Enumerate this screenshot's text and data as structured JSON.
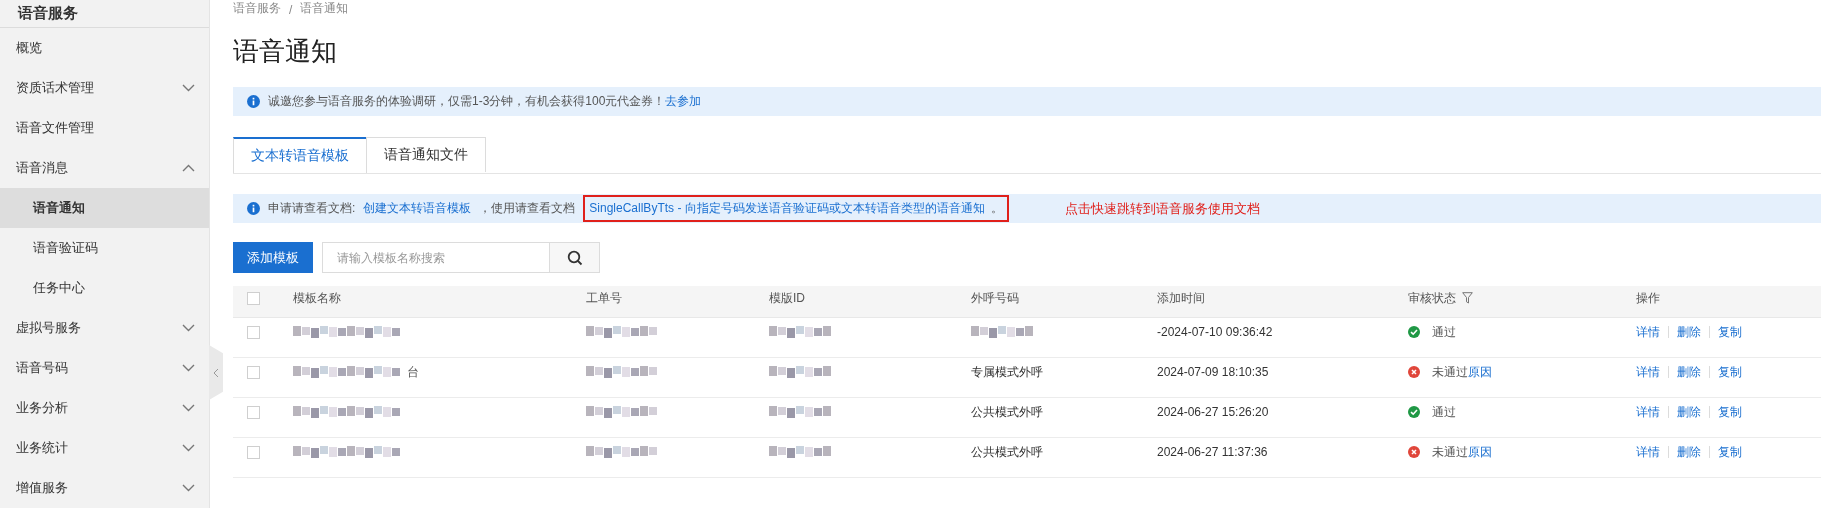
{
  "sidebar": {
    "title": "语音服务",
    "items": [
      {
        "label": "概览"
      },
      {
        "label": "资质话术管理",
        "expanded": false
      },
      {
        "label": "语音文件管理"
      },
      {
        "label": "语音消息",
        "expanded": true,
        "children": [
          {
            "label": "语音通知",
            "selected": true
          },
          {
            "label": "语音验证码",
            "selected": false
          },
          {
            "label": "任务中心",
            "selected": false
          }
        ]
      },
      {
        "label": "虚拟号服务",
        "expanded": false
      },
      {
        "label": "语音号码",
        "expanded": false
      },
      {
        "label": "业务分析",
        "expanded": false
      },
      {
        "label": "业务统计",
        "expanded": false
      },
      {
        "label": "增值服务",
        "expanded": false
      }
    ]
  },
  "breadcrumb": [
    "语音服务",
    "/",
    "语音通知"
  ],
  "page_title": "语音通知",
  "survey_notice": {
    "text": "诚邀您参与语音服务的体验调研，仅需1-3分钟，有机会获得100元代金券！",
    "link": "去参加"
  },
  "tabs": [
    {
      "label": "文本转语音模板",
      "selected": true
    },
    {
      "label": "语音通知文件",
      "selected": false
    }
  ],
  "doc_notice": {
    "prefix": "申请请查看文档:",
    "link1": "创建文本转语音模板",
    "middle": "，使用请查看文档",
    "link2": "SingleCallByTts - 向指定号码发送语音验证码或文本转语音类型的语音通知",
    "suffix": "。",
    "annotation": "点击快速跳转到语音服务使用文档"
  },
  "add_button": "添加模板",
  "search": {
    "placeholder": "请输入模板名称搜索"
  },
  "table": {
    "all_checked": false,
    "columns": [
      "模板名称",
      "工单号",
      "模版ID",
      "外呼号码",
      "添加时间",
      "审核状态",
      "操作"
    ],
    "rows": [
      {
        "checked": false,
        "name": {
          "blurred": true
        },
        "order": {
          "blurred": true
        },
        "id": {
          "blurred": true
        },
        "caller": {
          "blurred": true
        },
        "time": "-2024-07-10 09:36:42",
        "status": {
          "kind": "pass",
          "label": "通过"
        },
        "actions": [
          "详情",
          "删除",
          "复制"
        ]
      },
      {
        "checked": false,
        "name": {
          "blurred": true,
          "suffix": "台"
        },
        "order": {
          "blurred": true
        },
        "id": {
          "blurred": true
        },
        "caller": {
          "text": "专属模式外呼"
        },
        "time": "2024-07-09 18:10:35",
        "status": {
          "kind": "fail",
          "label": "未通过",
          "link": "原因"
        },
        "actions": [
          "详情",
          "删除",
          "复制"
        ]
      },
      {
        "checked": false,
        "name": {
          "blurred": true
        },
        "order": {
          "blurred": true
        },
        "id": {
          "blurred": true
        },
        "caller": {
          "text": "公共模式外呼"
        },
        "time": "2024-06-27 15:26:20",
        "status": {
          "kind": "pass",
          "label": "通过"
        },
        "actions": [
          "详情",
          "删除",
          "复制"
        ]
      },
      {
        "checked": false,
        "name": {
          "blurred": true
        },
        "order": {
          "blurred": true
        },
        "id": {
          "blurred": true
        },
        "caller": {
          "text": "公共模式外呼"
        },
        "time": "2024-06-27 11:37:36",
        "status": {
          "kind": "fail",
          "label": "未通过",
          "link": "原因"
        },
        "actions": [
          "详情",
          "删除",
          "复制"
        ]
      }
    ]
  }
}
